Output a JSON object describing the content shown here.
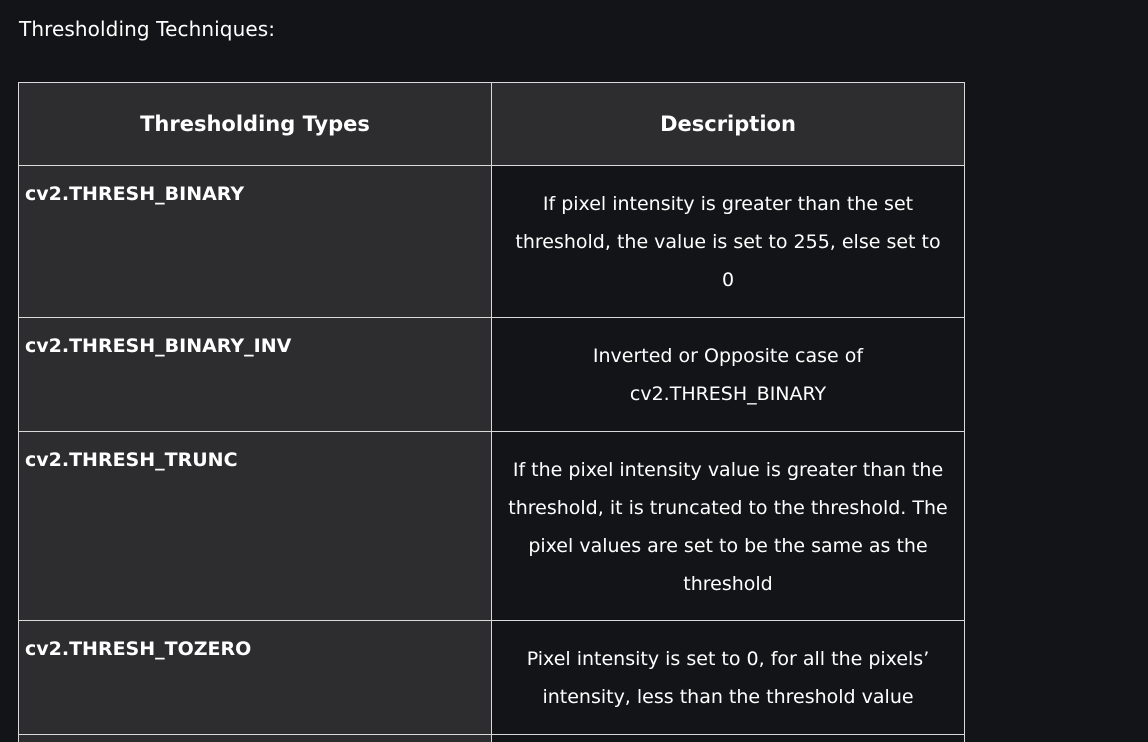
{
  "intro": "Thresholding Techniques:",
  "table": {
    "headers": [
      "Thresholding Types",
      "Description"
    ],
    "rows": [
      {
        "type": "cv2.THRESH_BINARY",
        "description": "If pixel intensity is greater than the set threshold, the value is set to 255, else set to 0"
      },
      {
        "type": "cv2.THRESH_BINARY_INV",
        "description": "Inverted or Opposite case of cv2.THRESH_BINARY"
      },
      {
        "type": "cv2.THRESH_TRUNC",
        "description": "If the pixel intensity value is greater than the threshold, it is truncated to the threshold. The pixel values are set to be the same as the threshold"
      },
      {
        "type": "cv2.THRESH_TOZERO",
        "description": "Pixel intensity is set to 0, for all the pixels’ intensity, less than the threshold value"
      }
    ]
  },
  "colors": {
    "page_background": "#131417",
    "header_cell_background": "#2d2d30",
    "border": "#d9d9d9",
    "text": "#ffffff"
  }
}
